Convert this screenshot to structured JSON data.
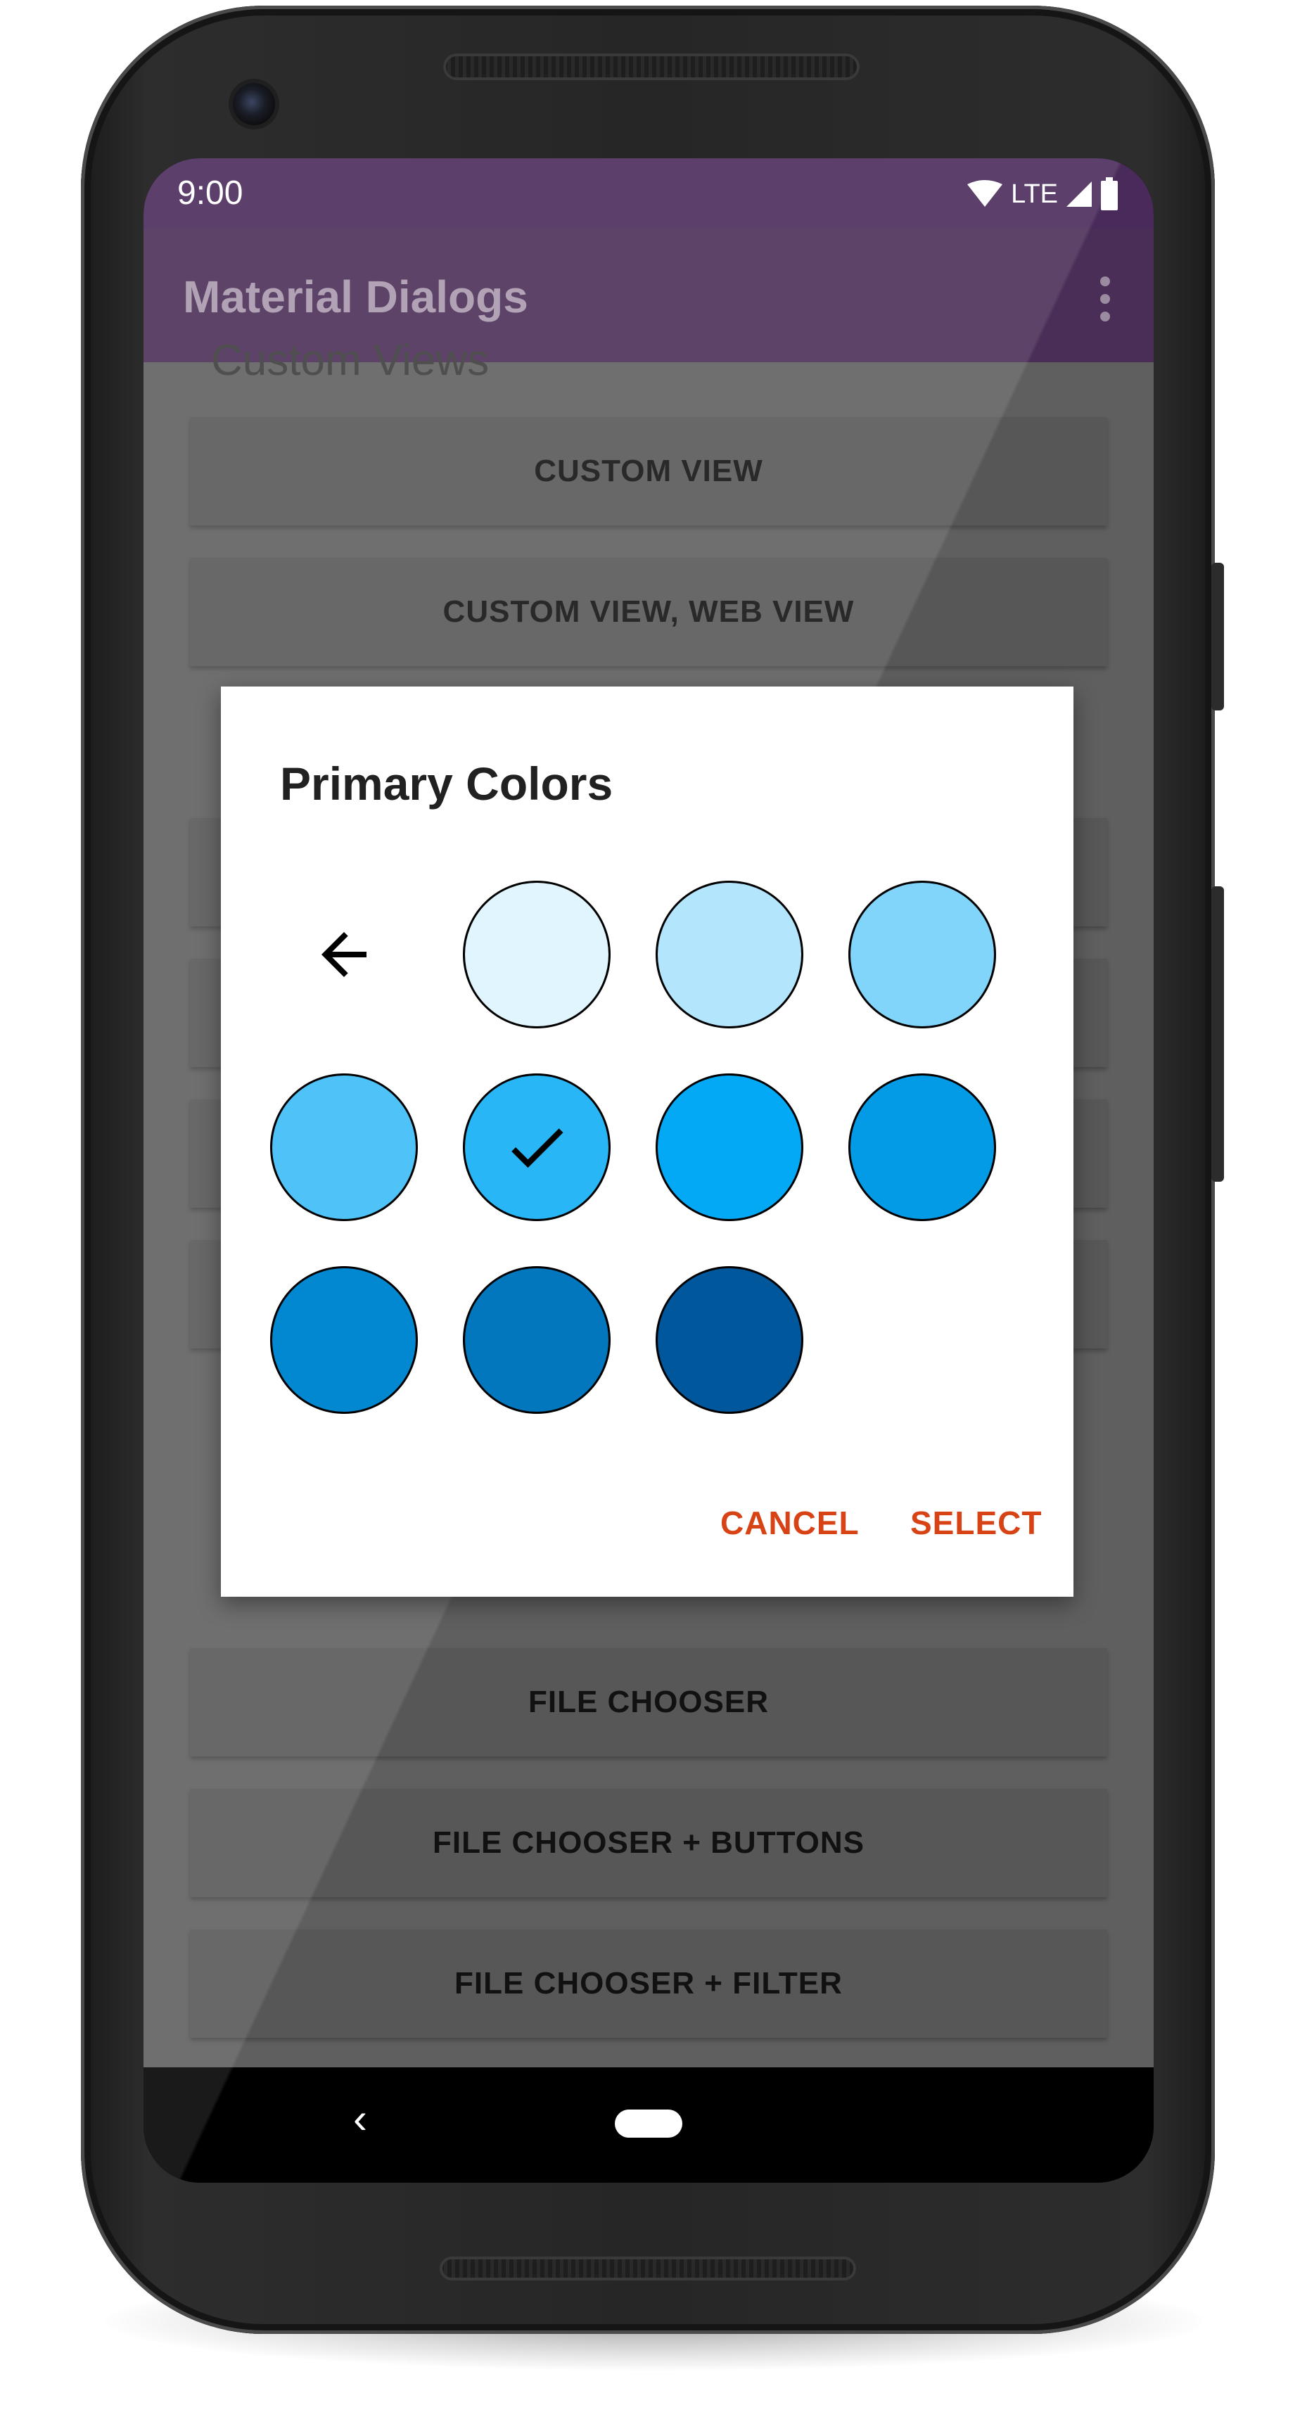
{
  "status_bar": {
    "time": "9:00",
    "network": "LTE"
  },
  "app_bar": {
    "title": "Material Dialogs"
  },
  "content": {
    "section_custom_views": "Custom Views",
    "buttons_top": [
      "CUSTOM VIEW",
      "CUSTOM VIEW, WEB VIEW"
    ],
    "buttons_bottom": [
      "FILE CHOOSER",
      "FILE CHOOSER + BUTTONS",
      "FILE CHOOSER + FILTER"
    ]
  },
  "dialog": {
    "title": "Primary Colors",
    "colors": [
      {
        "hex": "#E1F5FE",
        "selected": false
      },
      {
        "hex": "#B3E5FC",
        "selected": false
      },
      {
        "hex": "#81D4FA",
        "selected": false
      },
      {
        "hex": "#4FC3F7",
        "selected": false
      },
      {
        "hex": "#29B6F6",
        "selected": true
      },
      {
        "hex": "#03A9F4",
        "selected": false
      },
      {
        "hex": "#039BE5",
        "selected": false
      },
      {
        "hex": "#0288D1",
        "selected": false
      },
      {
        "hex": "#0277BD",
        "selected": false
      },
      {
        "hex": "#01579B",
        "selected": false
      }
    ],
    "cancel_label": "CANCEL",
    "select_label": "SELECT",
    "accent_color": "#D84315"
  },
  "icons": {
    "back": "arrow-left-icon",
    "check": "check-icon",
    "overflow": "more-vert-icon",
    "wifi": "wifi-icon",
    "signal": "signal-icon",
    "battery": "battery-icon"
  }
}
